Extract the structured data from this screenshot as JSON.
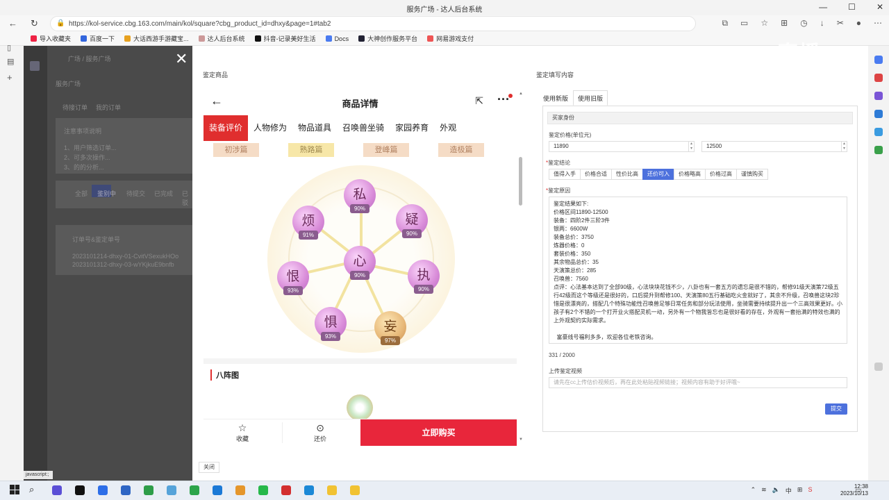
{
  "browser": {
    "tab_title": "服务广场 - 达人后台系统",
    "url": "https://kol-service.cbg.163.com/main/kol/square?cbg_product_id=dhxy&page=1#tab2",
    "bookmarks": [
      {
        "label": "导入收藏夹",
        "color": "#e24"
      },
      {
        "label": "百度一下",
        "color": "#3366dd"
      },
      {
        "label": "大话西游手游藏宝...",
        "color": "#e7a11f"
      },
      {
        "label": "达人后台系统",
        "color": "#c99"
      },
      {
        "label": "抖音-记录美好生活",
        "color": "#111"
      },
      {
        "label": "Docs",
        "color": "#4a7bf0"
      },
      {
        "label": "大神创作服务平台",
        "color": "#223"
      },
      {
        "label": "网易游戏支付",
        "color": "#e55"
      }
    ],
    "status_url": "javascript:;"
  },
  "bg_page": {
    "breadcrumb": "广场 / 服务广场",
    "title": "服务广场",
    "tabs": [
      "待接订单",
      "我的订单"
    ],
    "notice_title": "注意事项说明",
    "notice_lines": [
      "1、用户筛选订单...",
      "2、可多次操作...",
      "3、的的分析..."
    ],
    "filters": [
      "全部",
      "鉴别中",
      "待提交",
      "已完成",
      "已驳"
    ],
    "order_header": "订单号&鉴定单号",
    "orders": [
      "2023101214-dhxy-01-CvitVSexukHOo",
      "2023101312-dhxy-03-wYKjkuE9bnfb"
    ]
  },
  "modal": {
    "left_title": "鉴定商品",
    "right_title": "鉴定填写内容",
    "close_label": "关闭"
  },
  "phone": {
    "title": "商品详情",
    "tabs": [
      {
        "label": "装备评价",
        "active": true
      },
      {
        "label": "人物修为",
        "active": false
      },
      {
        "label": "物品道具",
        "active": false
      },
      {
        "label": "召唤兽坐骑",
        "active": false
      },
      {
        "label": "家园养育",
        "active": false
      },
      {
        "label": "外观",
        "active": false
      }
    ],
    "stages": [
      {
        "label": "初涉篇",
        "active": false
      },
      {
        "label": "熟路篇",
        "active": true
      },
      {
        "label": "登峰篇",
        "active": false
      },
      {
        "label": "造极篇",
        "active": false
      }
    ],
    "orbs": [
      {
        "char": "私",
        "pct": "90%",
        "gold": false
      },
      {
        "char": "疑",
        "pct": "90%",
        "gold": false
      },
      {
        "char": "执",
        "pct": "90%",
        "gold": false
      },
      {
        "char": "妄",
        "pct": "97%",
        "gold": true
      },
      {
        "char": "惧",
        "pct": "93%",
        "gold": false
      },
      {
        "char": "恨",
        "pct": "93%",
        "gold": false
      },
      {
        "char": "烦",
        "pct": "91%",
        "gold": false
      },
      {
        "char": "心",
        "pct": "90%",
        "gold": false
      }
    ],
    "bazhen_title": "八阵图",
    "bottom": {
      "fav_label": "收藏",
      "bargain_label": "还价",
      "buy_label": "立即购买"
    }
  },
  "form": {
    "tabs": [
      {
        "label": "使用新版",
        "active": false
      },
      {
        "label": "使用旧版",
        "active": true
      }
    ],
    "section_head": "买家身份",
    "price_label": "鉴定价格(单位元)",
    "price_min": "11890",
    "price_max": "12500",
    "conclusion_label": "鉴定结论",
    "conclusions": [
      {
        "label": "值得入手",
        "active": false
      },
      {
        "label": "价格合适",
        "active": false
      },
      {
        "label": "性价比高",
        "active": false
      },
      {
        "label": "还价可入",
        "active": true
      },
      {
        "label": "价格略高",
        "active": false
      },
      {
        "label": "价格过高",
        "active": false
      },
      {
        "label": "谨慎购买",
        "active": false
      }
    ],
    "reason_label": "鉴定原因",
    "reason_text": "鉴定结果如下:\n价格区间11890-12500\n装备：四阶2件三阶3件\n银两：6600W\n装备总价：3750\n炼器价格：0\n套装价格：350\n其余物品总价：35\n天演策总价：285\n召唤兽：7560\n点评：心法基本达到了全部90级，心法块块花钱不少，八卦也有一套五方的遗忘是很不错的，帮修91级天演策72级五行42级而这个等级还是很好的，口后提升到帮修100、天演策80五行基础吃火金就好了，其余不升级，召唤兽这块2珍惜是很漂亮的，搭配几个特殊功能性召唤兽足够日常任务和部分玩法使用，坐骑需要持续提升出一个三高效果更好。小孩子有2个不错的一个打开业火搭配灵机一动，另外有一个物我皆忘也是很好看的存在，外观有一套抬满的特效也满的上外观契约实际需求。\n\n  富豪线号福利多多，欢迎各位老铁咨询。",
    "char_count": "331 / 2000",
    "video_label": "上传鉴定视频",
    "video_placeholder": "请先在cc上传估价视频后，再在此处粘贴视频链接；视频内容有助于好评哦~",
    "submit_label": "提交"
  },
  "watermark": "CC直播",
  "taskbar": {
    "time": "12:38",
    "date": "2023/10/13",
    "ime": "中"
  }
}
